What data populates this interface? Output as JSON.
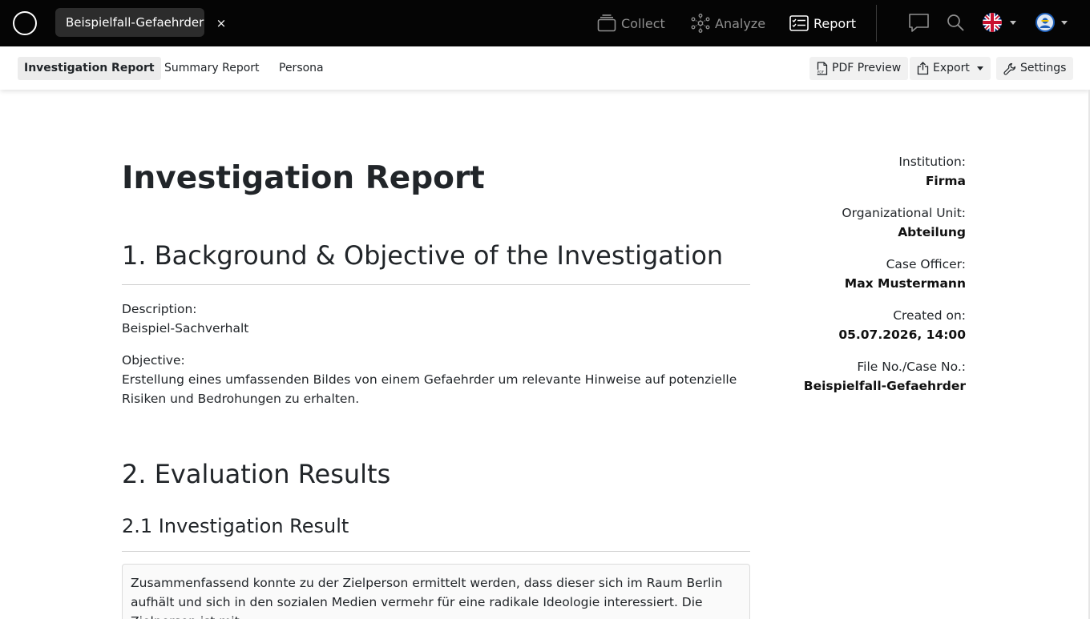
{
  "topbar": {
    "case_tab": "Beispielfall-Gefaehrder",
    "close": "×",
    "nav": {
      "collect": "Collect",
      "analyze": "Analyze",
      "report": "Report"
    },
    "icons": {
      "logo": "circle-logo-icon",
      "chat": "chat-bubble-icon",
      "search": "search-icon",
      "flag": "uk-flag-icon",
      "avatar": "user-avatar-icon"
    }
  },
  "subbar": {
    "tabs": [
      "Investigation Report",
      "Summary Report",
      "Persona"
    ],
    "actions": {
      "pdf_preview": "PDF Preview",
      "export": "Export",
      "settings": "Settings"
    }
  },
  "report": {
    "title": "Investigation Report",
    "section1": {
      "heading": "1. Background & Objective of the Investigation",
      "description_label": "Description:",
      "description": "Beispiel-Sachverhalt",
      "objective_label": "Objective:",
      "objective": "Erstellung eines umfassenden Bildes von einem Gefaehrder um relevante Hinweise auf potenzielle Risiken und Bedrohungen zu erhalten."
    },
    "section2": {
      "heading": "2. Evaluation Results",
      "sub_heading": "2.1 Investigation Result",
      "result_text": "Zusammenfassend konnte zu der Zielperson ermittelt werden, dass dieser sich im Raum Berlin aufhält und sich in den sozialen Medien vermehr für eine radikale Ideologie interessiert. Die Zielperson ist mit"
    },
    "meta": [
      {
        "label": "Institution:",
        "value": "Firma"
      },
      {
        "label": "Organizational Unit:",
        "value": "Abteilung"
      },
      {
        "label": "Case Officer:",
        "value": "Max Mustermann"
      },
      {
        "label": "Created on:",
        "value": "05.07.2026, 14:00"
      },
      {
        "label": "File No./Case No.:",
        "value": "Beispielfall-Gefaehrder"
      }
    ]
  },
  "colors": {
    "topbar_bg": "#050505",
    "tab_bg": "#2c2c2c",
    "nav_dim": "#8f8f8f",
    "nav_active": "#ffffff"
  }
}
